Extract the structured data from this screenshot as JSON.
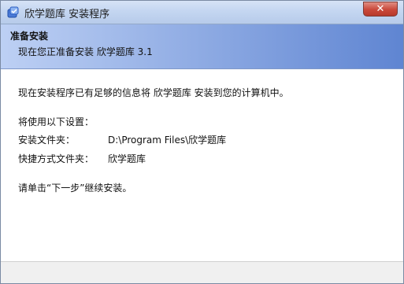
{
  "window": {
    "title": "欣学题库 安装程序",
    "icon": "installer-icon",
    "close_icon": "close-icon"
  },
  "header": {
    "title": "准备安装",
    "subtitle": "现在您正准备安装 欣学题库 3.1"
  },
  "content": {
    "intro": "现在安装程序已有足够的信息将 欣学题库 安装到您的计算机中。",
    "settings_heading": "将使用以下设置：",
    "install_folder_label": "安装文件夹：",
    "install_folder_value": "D:\\Program Files\\欣学题库",
    "shortcut_folder_label": "快捷方式文件夹：",
    "shortcut_folder_value": "欣学题库",
    "instruction": "请单击“下一步”继续安装。"
  },
  "colors": {
    "titlebar": "#c4d6f1",
    "header_gradient_start": "#bdd0f4",
    "header_gradient_end": "#5f85d2",
    "close_button": "#c9483a"
  }
}
